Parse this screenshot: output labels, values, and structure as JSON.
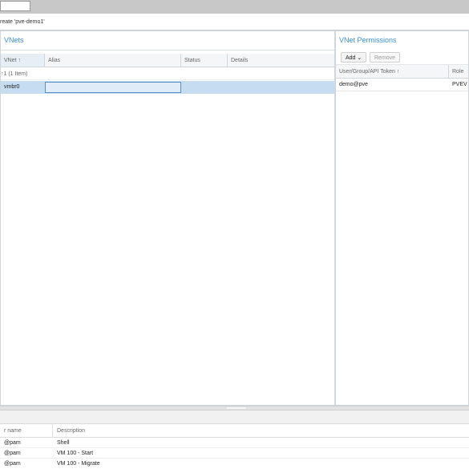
{
  "context": "reate 'pve-demo1'",
  "vnets": {
    "title": "VNets",
    "columns": [
      "VNet ↑",
      "Alias",
      "Status",
      "Details"
    ],
    "group_label": "↑1 (1 Item)",
    "rows": [
      {
        "vnet": "vmbr0",
        "alias": "",
        "status": "",
        "details": ""
      }
    ]
  },
  "permissions": {
    "title": "VNet Permissions",
    "add_label": "Add ⌄",
    "remove_label": "Remove",
    "columns": [
      "User/Group/API Token ↑",
      "Role"
    ],
    "rows": [
      {
        "user": "demo@pve",
        "role": "PVEV"
      }
    ]
  },
  "tasks": {
    "columns": [
      "r name",
      "Description"
    ],
    "rows": [
      {
        "user": "@pam",
        "desc": "Shell"
      },
      {
        "user": "@pam",
        "desc": "VM 100 - Start"
      },
      {
        "user": "@pam",
        "desc": "VM 100 - Migrate"
      }
    ]
  }
}
